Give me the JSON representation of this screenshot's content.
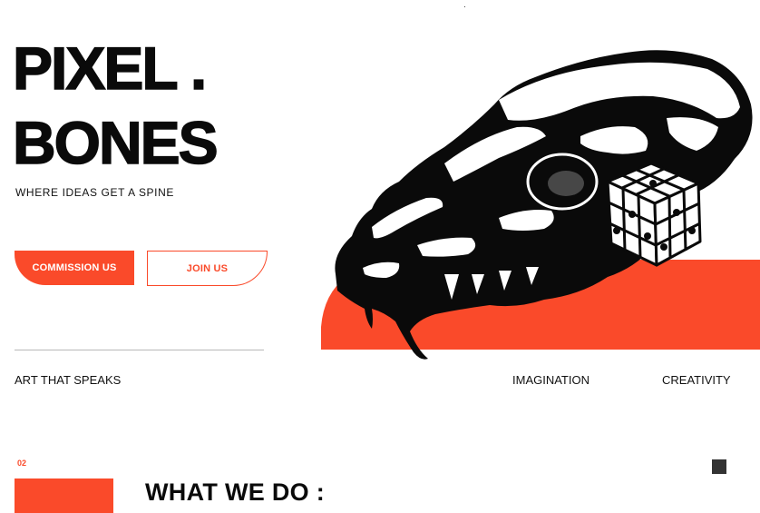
{
  "brand": {
    "line1": "PIXEL .",
    "line2": "BONES",
    "tagline": "WHERE IDEAS GET A SPINE"
  },
  "buttons": {
    "commission_label": "COMMISSION US",
    "join_label": "JOIN US"
  },
  "labels": {
    "art": "ART THAT SPEAKS",
    "imagination": "IMAGINATION",
    "creativity": "CREATIVITY"
  },
  "section": {
    "number": "02",
    "title": "WHAT WE DO :"
  },
  "hero": {
    "icons": [
      "skull-illustration",
      "dice-cube-illustration"
    ]
  },
  "colors": {
    "accent": "#fa4a2a",
    "text": "#0a0a0a",
    "background": "#ffffff"
  }
}
